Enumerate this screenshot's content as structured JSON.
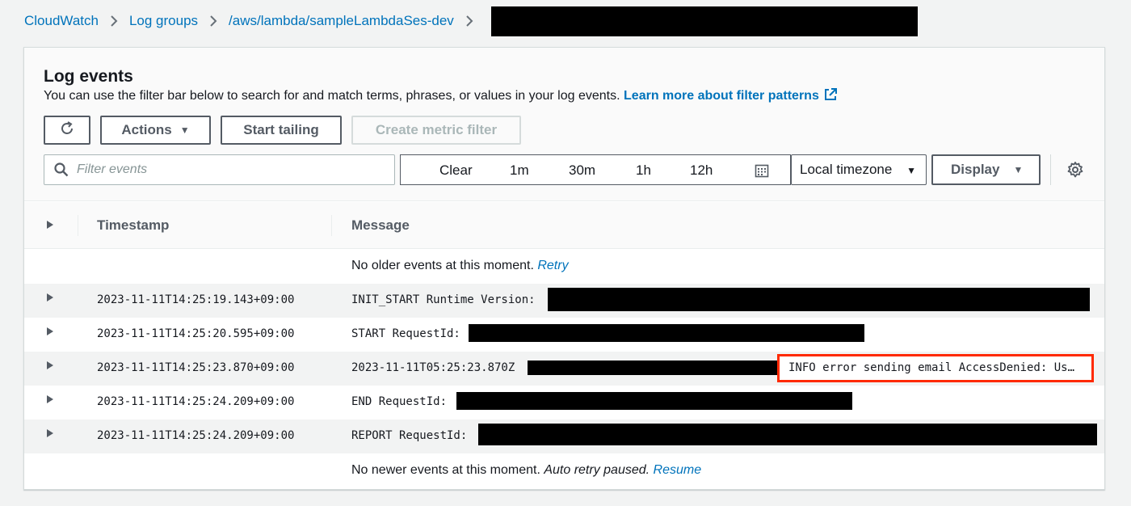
{
  "breadcrumb": {
    "items": [
      "CloudWatch",
      "Log groups",
      "/aws/lambda/sampleLambdaSes-dev"
    ]
  },
  "panel": {
    "title": "Log events",
    "description": "You can use the filter bar below to search for and match terms, phrases, or values in your log events.",
    "learn_more": "Learn more about filter patterns"
  },
  "toolbar": {
    "actions_label": "Actions",
    "start_tailing_label": "Start tailing",
    "create_metric_filter_label": "Create metric filter"
  },
  "filter": {
    "placeholder": "Filter events"
  },
  "time_range": {
    "clear": "Clear",
    "options": [
      "1m",
      "30m",
      "1h",
      "12h"
    ]
  },
  "timezone": {
    "selected": "Local timezone"
  },
  "display": {
    "label": "Display"
  },
  "table": {
    "headers": {
      "timestamp": "Timestamp",
      "message": "Message"
    },
    "no_older": {
      "text": "No older events at this moment.",
      "link": "Retry"
    },
    "rows": [
      {
        "timestamp": "2023-11-11T14:25:19.143+09:00",
        "message": "INIT_START Runtime Version:"
      },
      {
        "timestamp": "2023-11-11T14:25:20.595+09:00",
        "message": "START RequestId:"
      },
      {
        "timestamp": "2023-11-11T14:25:23.870+09:00",
        "message": "2023-11-11T05:25:23.870Z",
        "highlight": "INFO error sending email AccessDenied: Us…"
      },
      {
        "timestamp": "2023-11-11T14:25:24.209+09:00",
        "message": "END RequestId:"
      },
      {
        "timestamp": "2023-11-11T14:25:24.209+09:00",
        "message": "REPORT RequestId:"
      }
    ],
    "no_newer": {
      "text": "No newer events at this moment.",
      "paused": "Auto retry paused.",
      "link": "Resume"
    }
  },
  "colors": {
    "link": "#0073bb",
    "highlight_border": "#ff2a00",
    "background": "#f2f3f3"
  }
}
